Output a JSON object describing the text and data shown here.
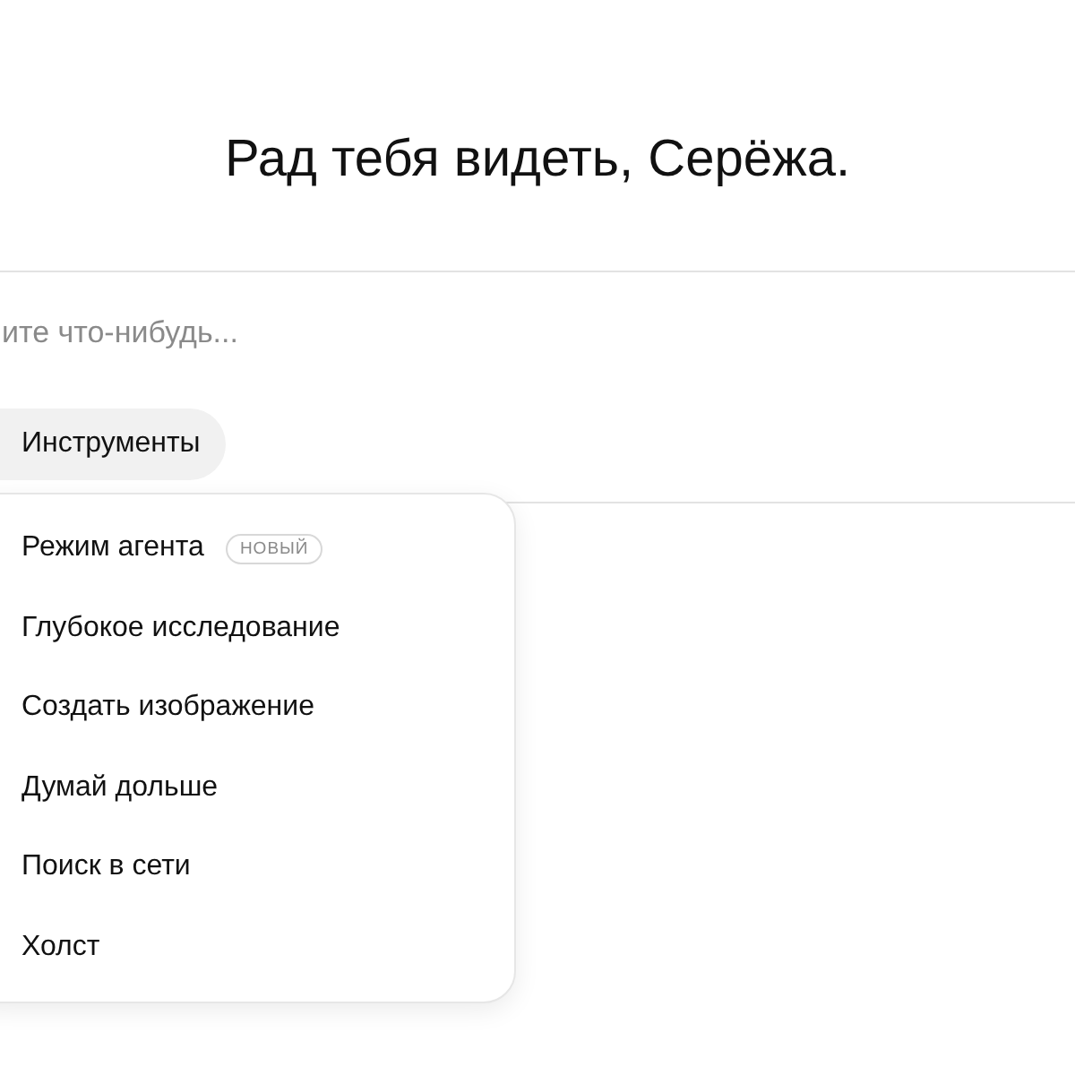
{
  "greeting": "Рад тебя видеть, Серёжа.",
  "composer": {
    "placeholder": "ите что-нибудь...",
    "tools_button": "Инструменты"
  },
  "tools_menu": [
    {
      "label": "Режим агента",
      "badge": "НОВЫЙ"
    },
    {
      "label": "Глубокое исследование"
    },
    {
      "label": "Создать изображение"
    },
    {
      "label": "Думай дольше"
    },
    {
      "label": "Поиск в сети"
    },
    {
      "label": "Холст"
    }
  ]
}
